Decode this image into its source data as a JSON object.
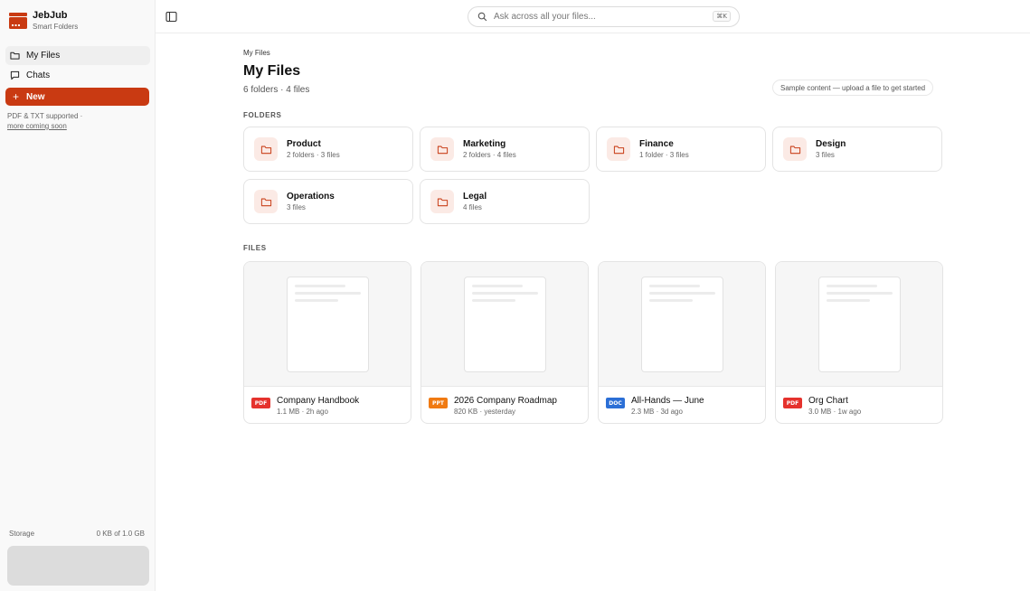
{
  "brand": {
    "name": "JebJub",
    "subtitle": "Smart Folders"
  },
  "sidebar": {
    "nav": [
      {
        "label": "My Files",
        "icon": "folder-icon",
        "active": true
      },
      {
        "label": "Chats",
        "icon": "chat-icon",
        "active": false
      }
    ],
    "new_label": "New",
    "support_text": "PDF & TXT supported ·",
    "support_link": "more coming soon",
    "storage_label": "Storage",
    "storage_value": "0 KB of 1.0 GB"
  },
  "search": {
    "placeholder": "Ask across all your files...",
    "shortcut": "⌘K"
  },
  "page": {
    "breadcrumb": "My Files",
    "title": "My Files",
    "summary": "6 folders · 4 files",
    "sample_note": "Sample content — upload a file to get started",
    "folders_label": "FOLDERS",
    "files_label": "FILES"
  },
  "folders": [
    {
      "name": "Product",
      "meta": "2 folders · 3 files"
    },
    {
      "name": "Marketing",
      "meta": "2 folders · 4 files"
    },
    {
      "name": "Finance",
      "meta": "1 folder · 3 files"
    },
    {
      "name": "Design",
      "meta": "3 files"
    },
    {
      "name": "Operations",
      "meta": "3 files"
    },
    {
      "name": "Legal",
      "meta": "4 files"
    }
  ],
  "files": [
    {
      "name": "Company Handbook",
      "meta": "1.1 MB · 2h ago",
      "type": "PDF",
      "badge_color": "#e5322d"
    },
    {
      "name": "2026 Company Roadmap",
      "meta": "820 KB · yesterday",
      "type": "PPT",
      "badge_color": "#f07a12"
    },
    {
      "name": "All-Hands — June",
      "meta": "2.3 MB · 3d ago",
      "type": "DOC",
      "badge_color": "#2b6fd6"
    },
    {
      "name": "Org Chart",
      "meta": "3.0 MB · 1w ago",
      "type": "PDF",
      "badge_color": "#e5322d"
    }
  ],
  "colors": {
    "accent": "#c93a12",
    "folder_bg": "#fbeae5",
    "folder_stroke": "#c9401a"
  }
}
